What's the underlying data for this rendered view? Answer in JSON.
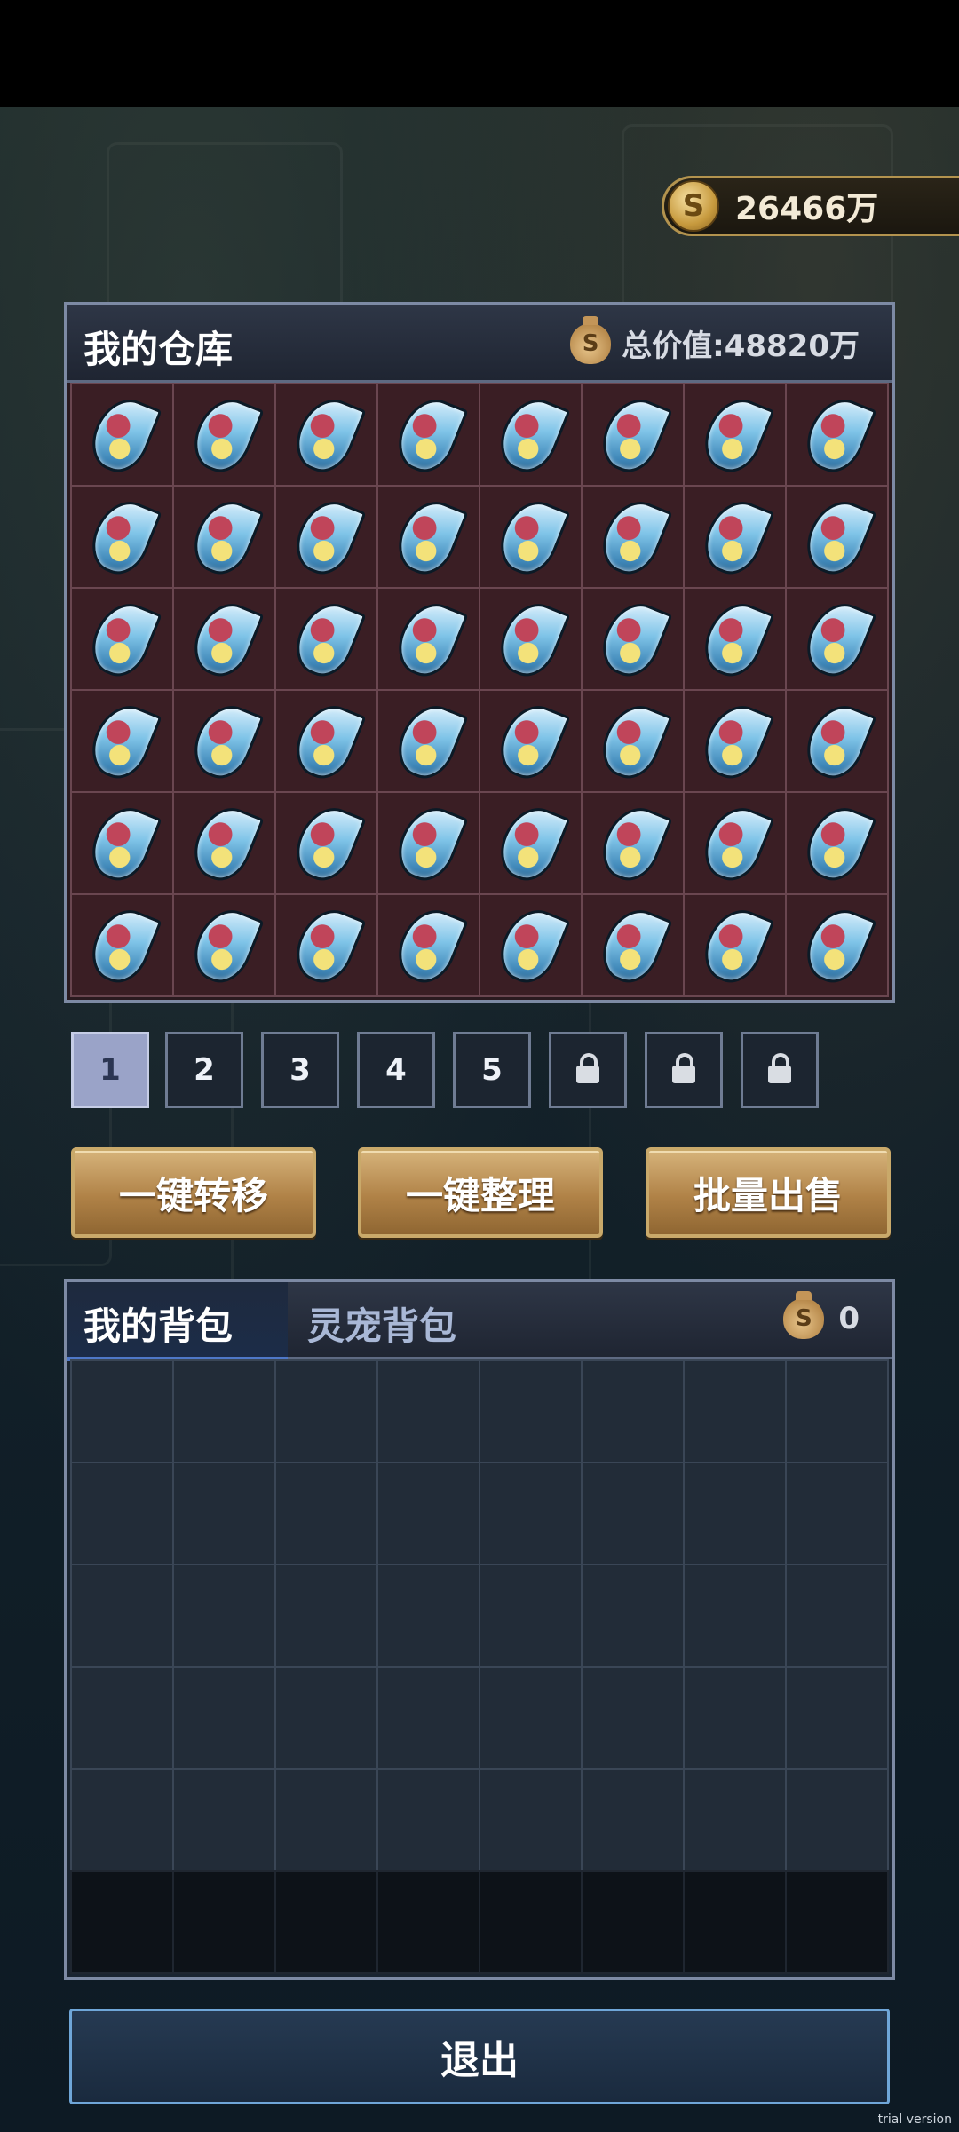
{
  "currency": {
    "icon": "coin-icon",
    "symbol": "S",
    "amount": "26466万"
  },
  "warehouse": {
    "title": "我的仓库",
    "total_label": "总价值: ",
    "total_value": "48820万",
    "bag_symbol": "S",
    "rows": 6,
    "cols": 8,
    "item_name": "crystal-shard-icon"
  },
  "pages": {
    "items": [
      "1",
      "2",
      "3",
      "4",
      "5"
    ],
    "locked_count": 3,
    "active_index": 0
  },
  "actions": {
    "transfer": "一键转移",
    "organize": "一键整理",
    "sell": "批量出售"
  },
  "backpack": {
    "tab_active": "我的背包",
    "tab_pet": "灵宠背包",
    "bag_symbol": "S",
    "value": "0",
    "rows": 6,
    "cols": 8
  },
  "exit_label": "退出",
  "watermark": "trial version",
  "colors": {
    "accent_gold": "#c9a96a",
    "panel_border": "#7d8aa4",
    "active_tab": "#4f78c8"
  }
}
